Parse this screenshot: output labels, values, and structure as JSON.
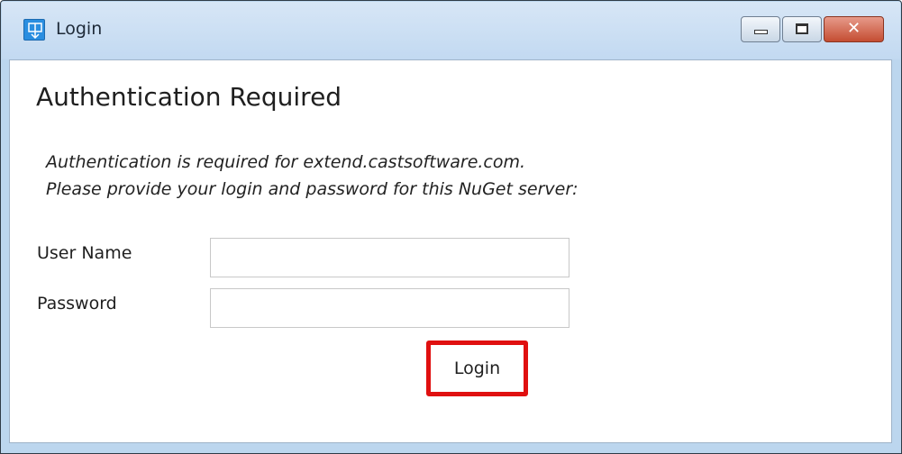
{
  "window": {
    "title": "Login",
    "icon": "nuget-package-icon",
    "controls": {
      "minimize_icon": "minimize-icon",
      "maximize_icon": "maximize-icon",
      "close_glyph": "✕"
    }
  },
  "dialog": {
    "heading": "Authentication Required",
    "message_line1": "Authentication is required for extend.castsoftware.com.",
    "message_line2": "Please provide your login and password for this NuGet server:"
  },
  "form": {
    "username_label": "User Name",
    "username_value": "",
    "password_label": "Password",
    "password_value": "",
    "login_button": "Login"
  },
  "colors": {
    "highlight": "#e01010",
    "titlebar": "#c2d9f1",
    "close_button": "#c44d32"
  }
}
